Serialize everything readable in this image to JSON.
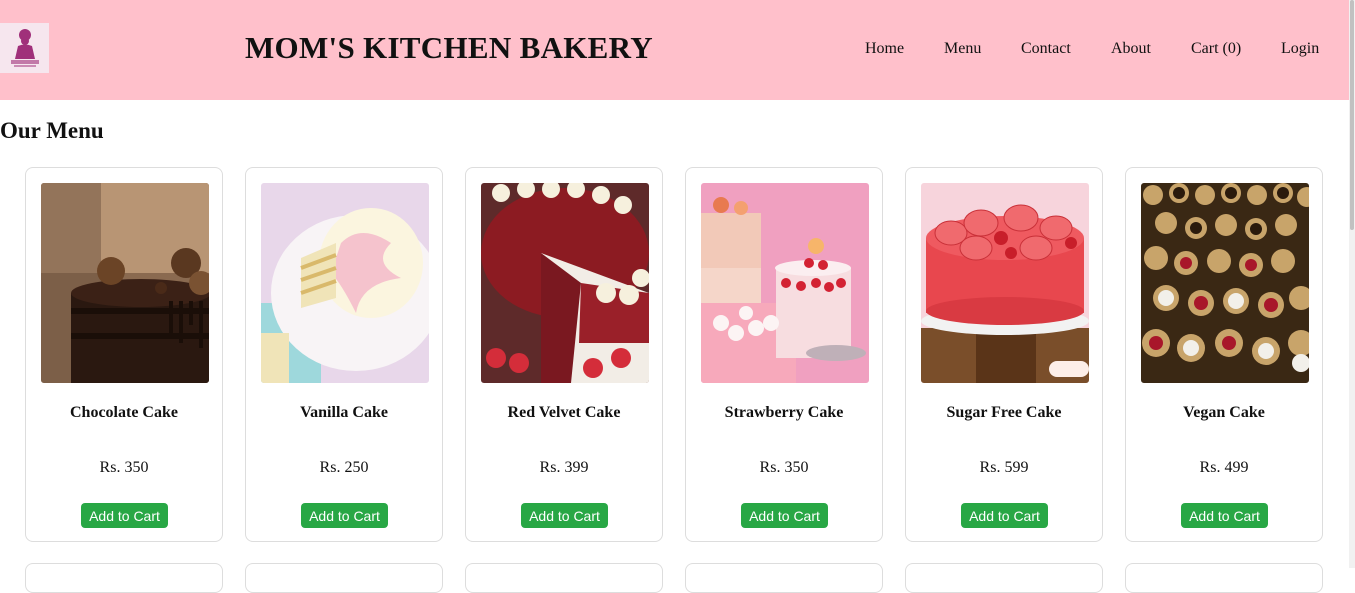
{
  "header": {
    "brand": "MOM'S KITCHEN BAKERY",
    "logo_icon": "chef-woman-logo-icon",
    "logo_text": "Mom's Kitchen",
    "background": "#ffc0cb",
    "nav": [
      {
        "label": "Home"
      },
      {
        "label": "Menu"
      },
      {
        "label": "Contact"
      },
      {
        "label": "About"
      },
      {
        "label": "Cart (0)"
      },
      {
        "label": "Login"
      }
    ]
  },
  "main": {
    "title": "Our Menu",
    "button_color": "#28a745",
    "products": [
      {
        "name": "Chocolate Cake",
        "price": "Rs. 350",
        "button": "Add to Cart",
        "image_icon": "chocolate-cake-image"
      },
      {
        "name": "Vanilla Cake",
        "price": "Rs. 250",
        "button": "Add to Cart",
        "image_icon": "vanilla-cake-image"
      },
      {
        "name": "Red Velvet Cake",
        "price": "Rs. 399",
        "button": "Add to Cart",
        "image_icon": "red-velvet-cake-image"
      },
      {
        "name": "Strawberry Cake",
        "price": "Rs. 350",
        "button": "Add to Cart",
        "image_icon": "strawberry-cake-image"
      },
      {
        "name": "Sugar Free Cake",
        "price": "Rs. 599",
        "button": "Add to Cart",
        "image_icon": "sugar-free-cake-image"
      },
      {
        "name": "Vegan Cake",
        "price": "Rs. 499",
        "button": "Add to Cart",
        "image_icon": "vegan-cake-image"
      }
    ]
  }
}
